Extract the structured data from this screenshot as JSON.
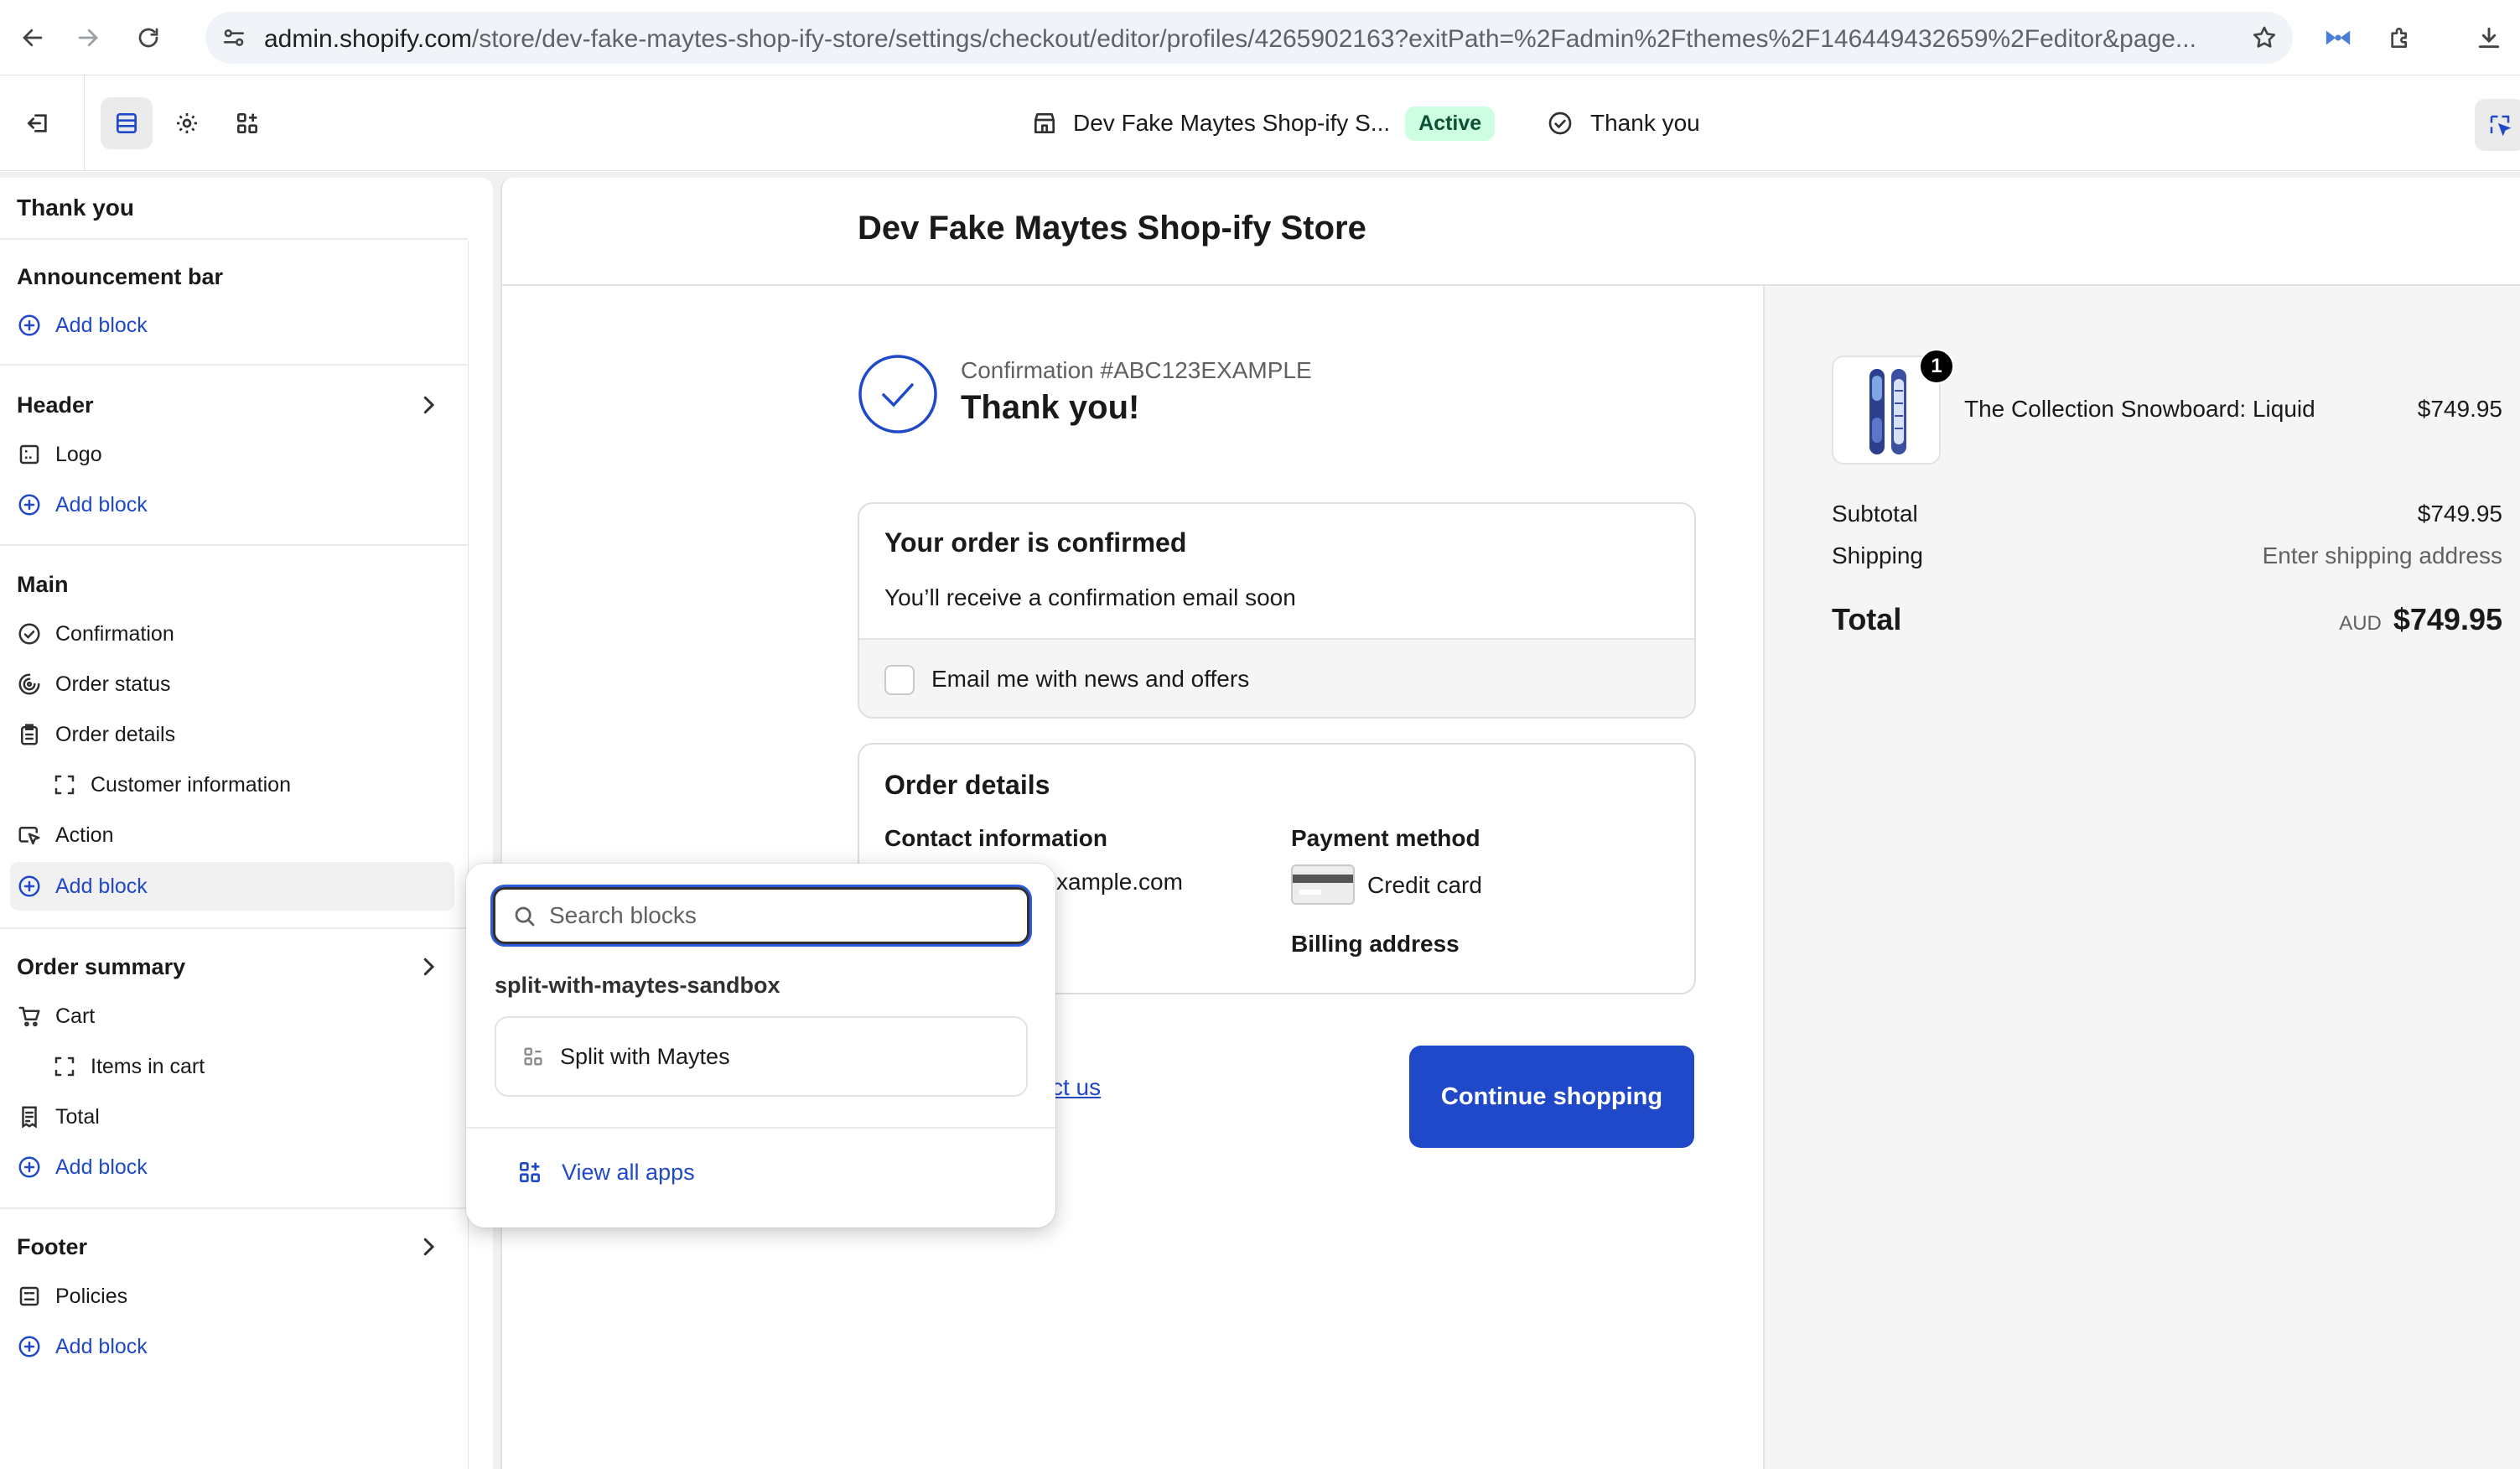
{
  "browser": {
    "url_host": "admin.shopify.com",
    "url_path": "/store/dev-fake-maytes-shop-ify-store/settings/checkout/editor/profiles/4265902163?exitPath=%2Fadmin%2Fthemes%2F146449432659%2Feditor&page..."
  },
  "editor_bar": {
    "store_name": "Dev Fake Maytes Shop-ify S...",
    "status_badge": "Active",
    "page_name": "Thank you"
  },
  "sidebar": {
    "title": "Thank you",
    "sections": {
      "announcement": {
        "title": "Announcement bar",
        "add_block": "Add block"
      },
      "header": {
        "title": "Header",
        "items": [
          "Logo"
        ],
        "add_block": "Add block"
      },
      "main": {
        "title": "Main",
        "items": [
          "Confirmation",
          "Order status",
          "Order details",
          "Customer information",
          "Action"
        ],
        "add_block": "Add block"
      },
      "order_summary": {
        "title": "Order summary",
        "items": [
          "Cart",
          "Items in cart",
          "Total"
        ],
        "add_block": "Add block"
      },
      "footer": {
        "title": "Footer",
        "items": [
          "Policies"
        ],
        "add_block": "Add block"
      }
    }
  },
  "preview": {
    "store_name": "Dev Fake Maytes Shop-ify Store",
    "confirmation_number": "Confirmation #ABC123EXAMPLE",
    "thank_you": "Thank you!",
    "order_confirmed": {
      "title": "Your order is confirmed",
      "text": "You’ll receive a confirmation email soon",
      "email_optin": "Email me with news and offers"
    },
    "order_details": {
      "title": "Order details",
      "contact_label": "Contact information",
      "contact_value": "xample.com",
      "payment_label": "Payment method",
      "payment_value": "Credit card",
      "billing_label": "Billing address"
    },
    "contact_link": "ct us",
    "continue_button": "Continue shopping"
  },
  "summary": {
    "product_name": "The Collection Snowboard: Liquid",
    "product_price": "$749.95",
    "quantity": "1",
    "subtotal_label": "Subtotal",
    "subtotal_value": "$749.95",
    "shipping_label": "Shipping",
    "shipping_value": "Enter shipping address",
    "total_label": "Total",
    "total_currency": "AUD",
    "total_value": "$749.95"
  },
  "popover": {
    "search_placeholder": "Search blocks",
    "group_title": "split-with-maytes-sandbox",
    "item_label": "Split with Maytes",
    "view_all": "View all apps"
  },
  "colors": {
    "accent": "#1f49c9",
    "active_badge_bg": "#cdfee1",
    "active_badge_text": "#0c5132"
  }
}
